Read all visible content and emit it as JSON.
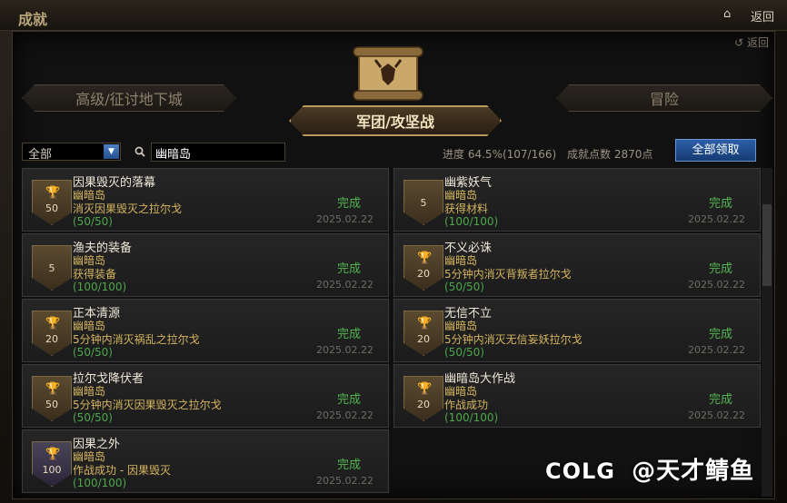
{
  "window": {
    "title": "成就",
    "back_label": "返回"
  },
  "panel": {
    "back_label": "返回"
  },
  "tabs": {
    "left": "高级/征讨地下城",
    "center": "军团/攻坚战",
    "right": "冒险"
  },
  "filter": {
    "selected": "全部"
  },
  "search": {
    "value": "幽暗岛"
  },
  "stats": {
    "progress_label": "进度",
    "progress_value": "64.5%(107/166)",
    "points_label": "成就点数",
    "points_value": "2870点"
  },
  "claim_all_label": "全部领取",
  "achievements": [
    {
      "title": "因果毁灭的落幕",
      "area": "幽暗岛",
      "desc": "消灭因果毁灭之拉尔戈",
      "progress": "(50/50)",
      "status": "完成",
      "date": "2025.02.22",
      "points": "50",
      "trophy": "gold-trophy-icon"
    },
    {
      "title": "幽紫妖气",
      "area": "幽暗岛",
      "desc": "获得材料",
      "progress": "(100/100)",
      "status": "完成",
      "date": "2025.02.22",
      "points": "5",
      "trophy": ""
    },
    {
      "title": "渔夫的装备",
      "area": "幽暗岛",
      "desc": "获得装备",
      "progress": "(100/100)",
      "status": "完成",
      "date": "2025.02.22",
      "points": "5",
      "trophy": ""
    },
    {
      "title": "不义必诛",
      "area": "幽暗岛",
      "desc": "5分钟内消灭背叛者拉尔戈",
      "progress": "(50/50)",
      "status": "完成",
      "date": "2025.02.22",
      "points": "20",
      "trophy": "silver-trophy-icon"
    },
    {
      "title": "正本清源",
      "area": "幽暗岛",
      "desc": "5分钟内消灭祸乱之拉尔戈",
      "progress": "(50/50)",
      "status": "完成",
      "date": "2025.02.22",
      "points": "20",
      "trophy": "silver-trophy-icon"
    },
    {
      "title": "无信不立",
      "area": "幽暗岛",
      "desc": "5分钟内消灭无信妄妖拉尔戈",
      "progress": "(50/50)",
      "status": "完成",
      "date": "2025.02.22",
      "points": "20",
      "trophy": "silver-trophy-icon"
    },
    {
      "title": "拉尔戈降伏者",
      "area": "幽暗岛",
      "desc": "5分钟内消灭因果毁灭之拉尔戈",
      "progress": "(50/50)",
      "status": "完成",
      "date": "2025.02.22",
      "points": "50",
      "trophy": "gold-trophy-icon"
    },
    {
      "title": "幽暗岛大作战",
      "area": "幽暗岛",
      "desc": "作战成功",
      "progress": "(100/100)",
      "status": "完成",
      "date": "2025.02.22",
      "points": "20",
      "trophy": "silver-trophy-icon"
    },
    {
      "title": "因果之外",
      "area": "幽暗岛",
      "desc": "作战成功 - 因果毁灭",
      "progress": "(100/100)",
      "status": "完成",
      "date": "2025.02.22",
      "points": "100",
      "trophy": "purple-trophy-icon"
    }
  ],
  "watermark": {
    "logo": "COLG",
    "text": "@天才鲭鱼"
  }
}
